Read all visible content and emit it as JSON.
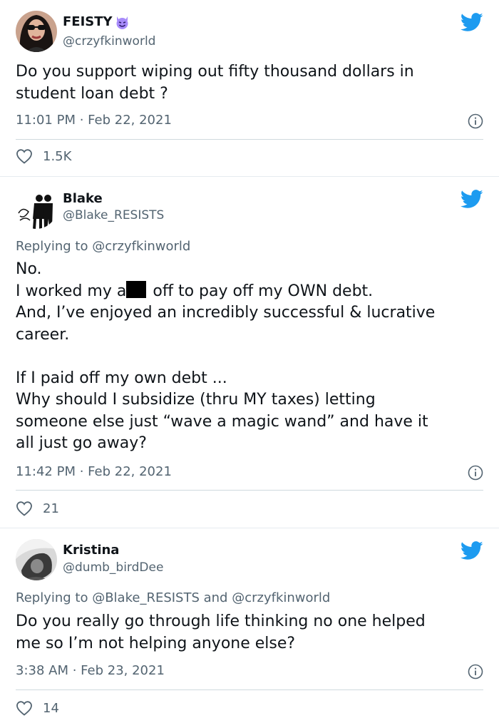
{
  "tweets": [
    {
      "name": "FEISTY",
      "handle": "@crzyfkinworld",
      "text": "Do you support wiping out fifty thousand dollars in\nstudent loan debt ?",
      "time": "11:01 PM · Feb 22, 2021",
      "likes": "1.5K"
    },
    {
      "name": "Blake",
      "handle": "@Blake_RESISTS",
      "replying_prefix": "Replying to ",
      "replying_to": "@crzyfkinworld",
      "line1": "No.",
      "line2_a": "I worked my a",
      "line2_b": " off to pay off my OWN debt.",
      "line3": "And, I’ve enjoyed an incredibly successful & lucrative\ncareer.",
      "line4": "If I paid off my own debt ...\nWhy should I subsidize (thru MY taxes) letting\nsomeone else just “wave a magic wand” and have it\nall just go away?",
      "time": "11:42 PM · Feb 22, 2021",
      "likes": "21"
    },
    {
      "name": "Kristina",
      "handle": "@dumb_birdDee",
      "replying_prefix": "Replying to ",
      "replying_to": "@Blake_RESISTS and @crzyfkinworld",
      "text": "Do you really go through life thinking no one helped\nme so I’m not helping anyone else?",
      "time": "3:38 AM · Feb 23, 2021",
      "likes": "14"
    }
  ],
  "colors": {
    "twitter_blue": "#1d9bf0",
    "secondary_text": "#536471",
    "primary_text": "#0f1419",
    "devil_purple": "#a78bfa"
  },
  "icons": {
    "brand": "twitter-bird-icon",
    "info": "info-circle-icon",
    "like": "heart-outline-icon",
    "emoji": "smiling-devil-emoji"
  }
}
